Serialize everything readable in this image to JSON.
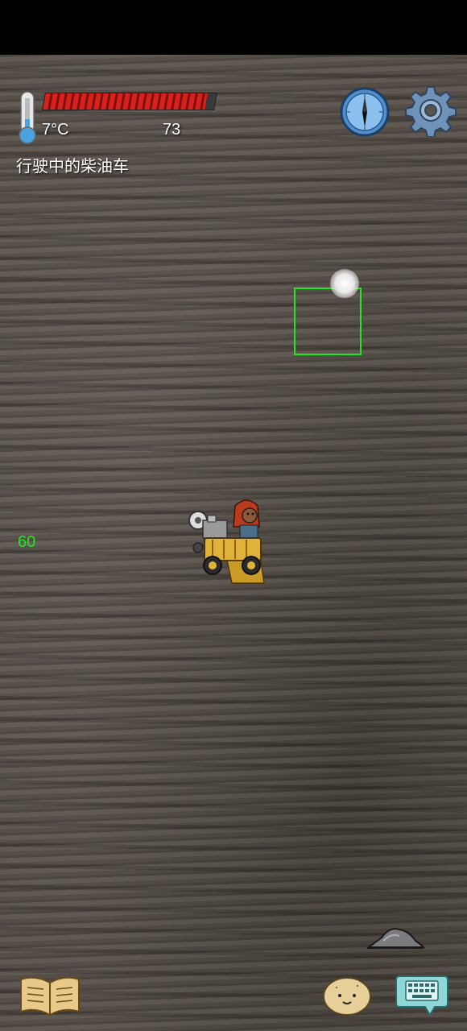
{
  "hud": {
    "temperature": "7°C",
    "food_count": "73",
    "heat_level": 0.95,
    "held_item_label": "行驶中的柴油车",
    "fps": "60",
    "heat_color": "#d8201d"
  },
  "icons": {
    "thermometer": "thermometer-icon",
    "compass": "compass-icon",
    "settings": "gear-icon",
    "book": "recipe-book-icon",
    "emote": "emote-face-icon",
    "keyboard": "keyboard-chat-icon"
  },
  "world": {
    "target_highlight_color": "#22e622"
  }
}
